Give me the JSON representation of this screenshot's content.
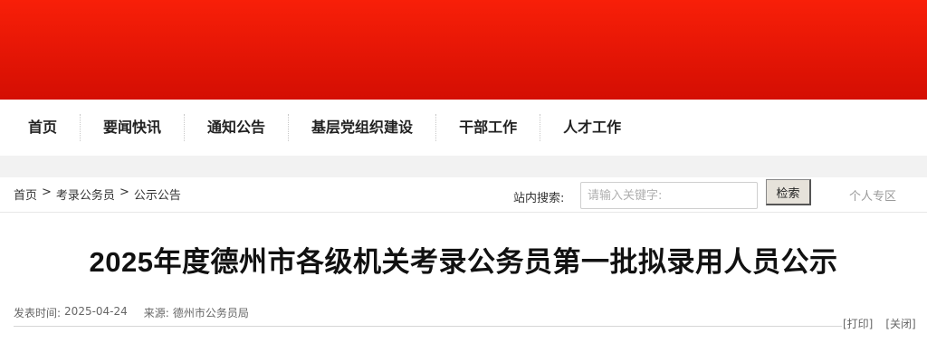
{
  "nav": {
    "items": [
      {
        "label": "首页"
      },
      {
        "label": "要闻快讯"
      },
      {
        "label": "通知公告"
      },
      {
        "label": "基层党组织建设"
      },
      {
        "label": "干部工作"
      },
      {
        "label": "人才工作"
      }
    ]
  },
  "breadcrumb": {
    "items": [
      "首页",
      "考录公务员",
      "公示公告"
    ],
    "separator": ">"
  },
  "search": {
    "label": "站内搜索:",
    "placeholder": "请输入关键字:",
    "value": "",
    "button_label": "检索"
  },
  "personal_link": "个人专区",
  "article": {
    "title": "2025年度德州市各级机关考录公务员第一批拟录用人员公示",
    "publish_label": "发表时间:",
    "publish_date": "2025-04-24",
    "source_label": "来源:",
    "source": "德州市公务员局"
  },
  "actions": {
    "print": "[打印]",
    "close": "[关闭]"
  },
  "colors": {
    "banner_top": "#f81f08",
    "banner_bottom": "#d40e03"
  }
}
